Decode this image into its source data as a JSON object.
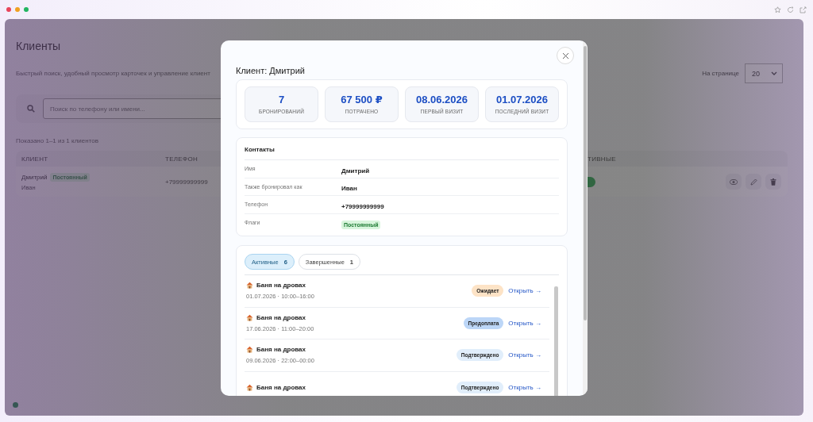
{
  "browser": {
    "dots": [
      {
        "color": "#e8445a"
      },
      {
        "color": "#f0a020"
      },
      {
        "color": "#22b560"
      }
    ]
  },
  "page": {
    "title": "Клиенты",
    "subtitle": "Быстрый поиск, удобный просмотр карточек и управление клиент",
    "per_page": {
      "label": "На странице",
      "value": "20"
    },
    "search": {
      "placeholder": "Поиск по телефону или имени..."
    },
    "shown": "Показано 1–1 из 1 клиентов",
    "table": {
      "columns": [
        "КЛИЕНТ",
        "ТЕЛЕФОН",
        "ТИВНЫЕ"
      ],
      "rows": [
        {
          "name": "Дмитрий",
          "badge": "Постоянный",
          "alias": "Иван",
          "phone": "+79999999999"
        }
      ]
    }
  },
  "modal": {
    "title": "Клиент: Дмитрий",
    "stats": [
      {
        "value": "7",
        "label": "БРОНИРОВАНИЙ"
      },
      {
        "value": "67 500 ₽",
        "label": "ПОТРАЧЕНО"
      },
      {
        "value": "08.06.2026",
        "label": "ПЕРВЫЙ ВИЗИТ"
      },
      {
        "value": "01.07.2026",
        "label": "ПОСЛЕДНИЙ ВИЗИТ"
      }
    ],
    "contacts": {
      "title": "Контакты",
      "rows": [
        {
          "label": "Имя",
          "value": "Дмитрий",
          "kind": "text"
        },
        {
          "label": "Также бронировал как",
          "value": "Иван",
          "kind": "text"
        },
        {
          "label": "Телефон",
          "value": "+79999999999",
          "kind": "text"
        },
        {
          "label": "Флаги",
          "value": "Постоянный",
          "kind": "badge"
        }
      ]
    },
    "bookings": {
      "tabs": [
        {
          "label": "Активные",
          "count": "6",
          "selected": true
        },
        {
          "label": "Завершенные",
          "count": "1",
          "selected": false
        }
      ],
      "items": [
        {
          "title": "Баня на дровах",
          "when": "01.07.2026 · 10:00–16:00",
          "status": "Ожидает",
          "kind": "pending",
          "link": "Открыть →"
        },
        {
          "title": "Баня на дровах",
          "when": "17.06.2026 · 11:00–20:00",
          "status": "Предоплата",
          "kind": "prepaid",
          "link": "Открыть →"
        },
        {
          "title": "Баня на дровах",
          "when": "09.06.2026 · 22:00–00:00",
          "status": "Подтверждено",
          "kind": "confirmed",
          "link": "Открыть →"
        },
        {
          "title": "Баня на дровах",
          "status": "Подтверждено",
          "kind": "confirmed",
          "link": "Открыть →"
        }
      ]
    }
  }
}
